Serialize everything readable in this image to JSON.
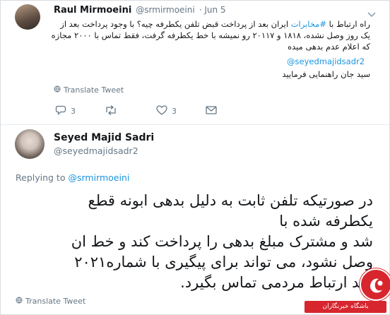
{
  "tweet1": {
    "name": "Raul Mirmoeini",
    "handle": "@srmirmoeini",
    "date": "· Jun 5",
    "text_prefix": "راه ارتباط با ",
    "hashtag": "#مخابرات",
    "text_rest": " ایران بعد از پرداخت قبض تلفن یکطرفه چیه؟ با وجود پرداخت بعد از یک روز وصل نشده، ۱۸۱۸ و ۲۰۱۱۷ رو نمیشه با خط یکطرفه گرفت، فقط تماس با ۲۰۰۰ مجازه که اعلام عدم بدهی میده",
    "mention": "@seyedmajidsadr2",
    "closing": "سید جان راهنمایی فرمایید",
    "translate": "Translate Tweet",
    "reply_count": "3",
    "like_count": "3"
  },
  "tweet2": {
    "name": "Seyed Majid Sadri",
    "handle": "@seyedmajidsadr2",
    "replying_label": "Replying to",
    "replying_to": "@srmirmoeini",
    "line1": "در صورتیکه تلفن ثابت به دلیل بدهی ابونه قطع",
    "line2": "یکطرفه شده با",
    "line3": "شد و مشترک مبلغ بدهی را پرداخت کند و خط ان",
    "line4": "وصل نشود، می تواند برای پیگیری با شماره۲۰۲۱",
    "line5": "احد ارتباط مردمی تماس بگیرد.",
    "translate": "Translate Tweet"
  },
  "watermark": {
    "label": "باشگاه خبرنگاران"
  }
}
